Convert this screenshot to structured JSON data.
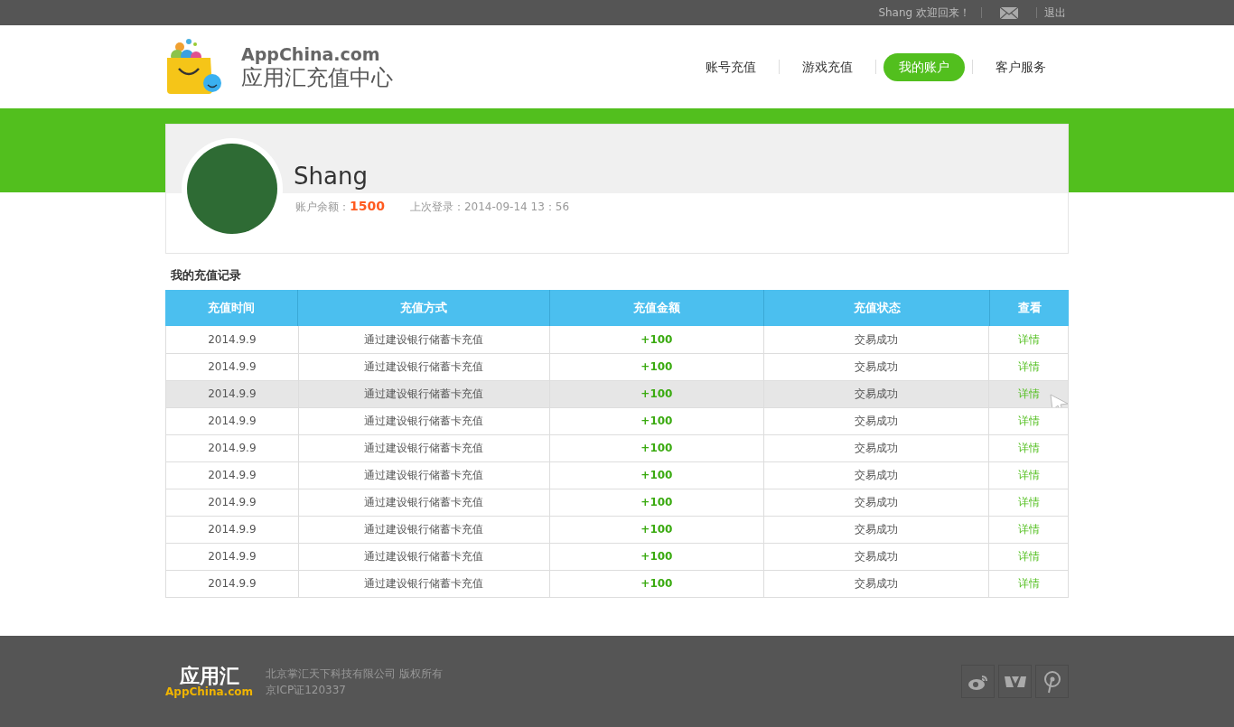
{
  "top_bar": {
    "greeting": "Shang 欢迎回来！",
    "logout": "退出"
  },
  "header": {
    "logo_brand": "AppChina.com",
    "logo_title": "应用汇充值中心",
    "nav": [
      {
        "label": "账号充值",
        "selected": false
      },
      {
        "label": "游戏充值",
        "selected": false
      },
      {
        "label": "我的账户",
        "selected": true
      },
      {
        "label": "客户服务",
        "selected": false
      }
    ]
  },
  "profile": {
    "name": "Shang",
    "balance_label": "账户余额：",
    "balance": "1500",
    "last_login": "上次登录：2014-09-14 13：56"
  },
  "records": {
    "title": "我的充值记录",
    "columns": [
      "充值时间",
      "充值方式",
      "充值金额",
      "充值状态",
      "查看"
    ],
    "rows": [
      {
        "date": "2014.9.9",
        "method": "通过建设银行储蓄卡充值",
        "amount": "+100",
        "status": "交易成功",
        "link": "详情",
        "selected": false
      },
      {
        "date": "2014.9.9",
        "method": "通过建设银行储蓄卡充值",
        "amount": "+100",
        "status": "交易成功",
        "link": "详情",
        "selected": false
      },
      {
        "date": "2014.9.9",
        "method": "通过建设银行储蓄卡充值",
        "amount": "+100",
        "status": "交易成功",
        "link": "详情",
        "selected": true
      },
      {
        "date": "2014.9.9",
        "method": "通过建设银行储蓄卡充值",
        "amount": "+100",
        "status": "交易成功",
        "link": "详情",
        "selected": false
      },
      {
        "date": "2014.9.9",
        "method": "通过建设银行储蓄卡充值",
        "amount": "+100",
        "status": "交易成功",
        "link": "详情",
        "selected": false
      },
      {
        "date": "2014.9.9",
        "method": "通过建设银行储蓄卡充值",
        "amount": "+100",
        "status": "交易成功",
        "link": "详情",
        "selected": false
      },
      {
        "date": "2014.9.9",
        "method": "通过建设银行储蓄卡充值",
        "amount": "+100",
        "status": "交易成功",
        "link": "详情",
        "selected": false
      },
      {
        "date": "2014.9.9",
        "method": "通过建设银行储蓄卡充值",
        "amount": "+100",
        "status": "交易成功",
        "link": "详情",
        "selected": false
      },
      {
        "date": "2014.9.9",
        "method": "通过建设银行储蓄卡充值",
        "amount": "+100",
        "status": "交易成功",
        "link": "详情",
        "selected": false
      },
      {
        "date": "2014.9.9",
        "method": "通过建设银行储蓄卡充值",
        "amount": "+100",
        "status": "交易成功",
        "link": "详情",
        "selected": false
      }
    ]
  },
  "footer": {
    "logo_cn": "应用汇",
    "logo_brand": "AppChina.com",
    "copyright": "北京掌汇天下科技有限公司 版权所有",
    "icp": "京ICP证120337"
  }
}
